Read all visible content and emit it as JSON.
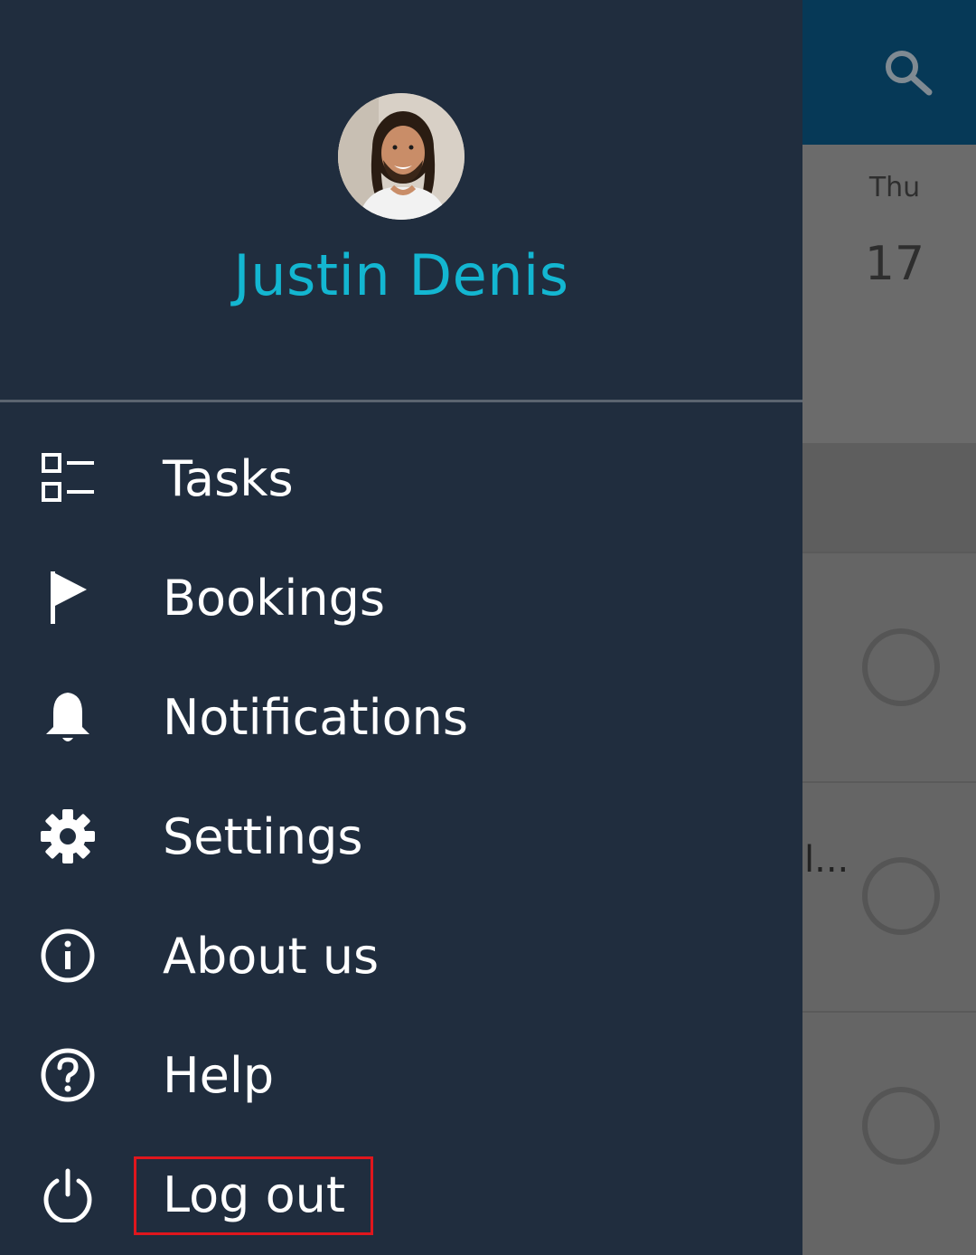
{
  "background_app": {
    "header_color": "#063957",
    "search_icon": "search-icon",
    "day_label": "Thu",
    "date_number": "17",
    "truncated_text": "l..."
  },
  "drawer": {
    "user": {
      "name": "Justin Denis",
      "name_color": "#13b6d1",
      "avatar": "avatar-photo"
    },
    "menu": [
      {
        "label": "Tasks",
        "icon": "tasks-list-icon"
      },
      {
        "label": "Bookings",
        "icon": "flag-icon"
      },
      {
        "label": "Notifications",
        "icon": "bell-icon"
      },
      {
        "label": "Settings",
        "icon": "gear-icon"
      },
      {
        "label": "About us",
        "icon": "info-icon"
      },
      {
        "label": "Help",
        "icon": "help-icon"
      },
      {
        "label": "Log out",
        "icon": "power-icon"
      }
    ],
    "background_color": "#202d3e",
    "highlighted_item": "Log out",
    "highlight_color": "#e0161d"
  }
}
